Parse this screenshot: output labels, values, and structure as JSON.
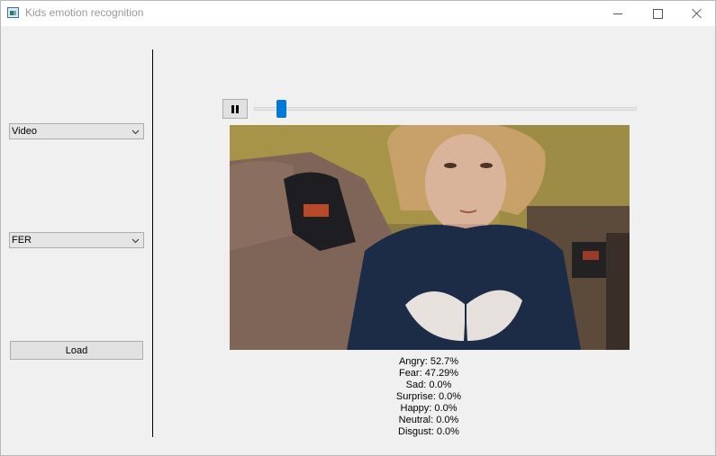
{
  "window": {
    "title": "Kids emotion recognition"
  },
  "controls": {
    "source_select": {
      "selected": "Video"
    },
    "model_select": {
      "selected": "FER"
    },
    "load_label": "Load"
  },
  "player": {
    "state": "playing",
    "progress": 0.06
  },
  "emotions": [
    {
      "label": "Angry",
      "value": "52.7%"
    },
    {
      "label": "Fear",
      "value": "47.29%"
    },
    {
      "label": "Sad",
      "value": "0.0%"
    },
    {
      "label": "Surprise",
      "value": "0.0%"
    },
    {
      "label": "Happy",
      "value": "0.0%"
    },
    {
      "label": "Neutral",
      "value": "0.0%"
    },
    {
      "label": "Disgust",
      "value": "0.0%"
    }
  ],
  "colors": {
    "accent": "#0078d7",
    "window_bg": "#f0f0f0"
  }
}
